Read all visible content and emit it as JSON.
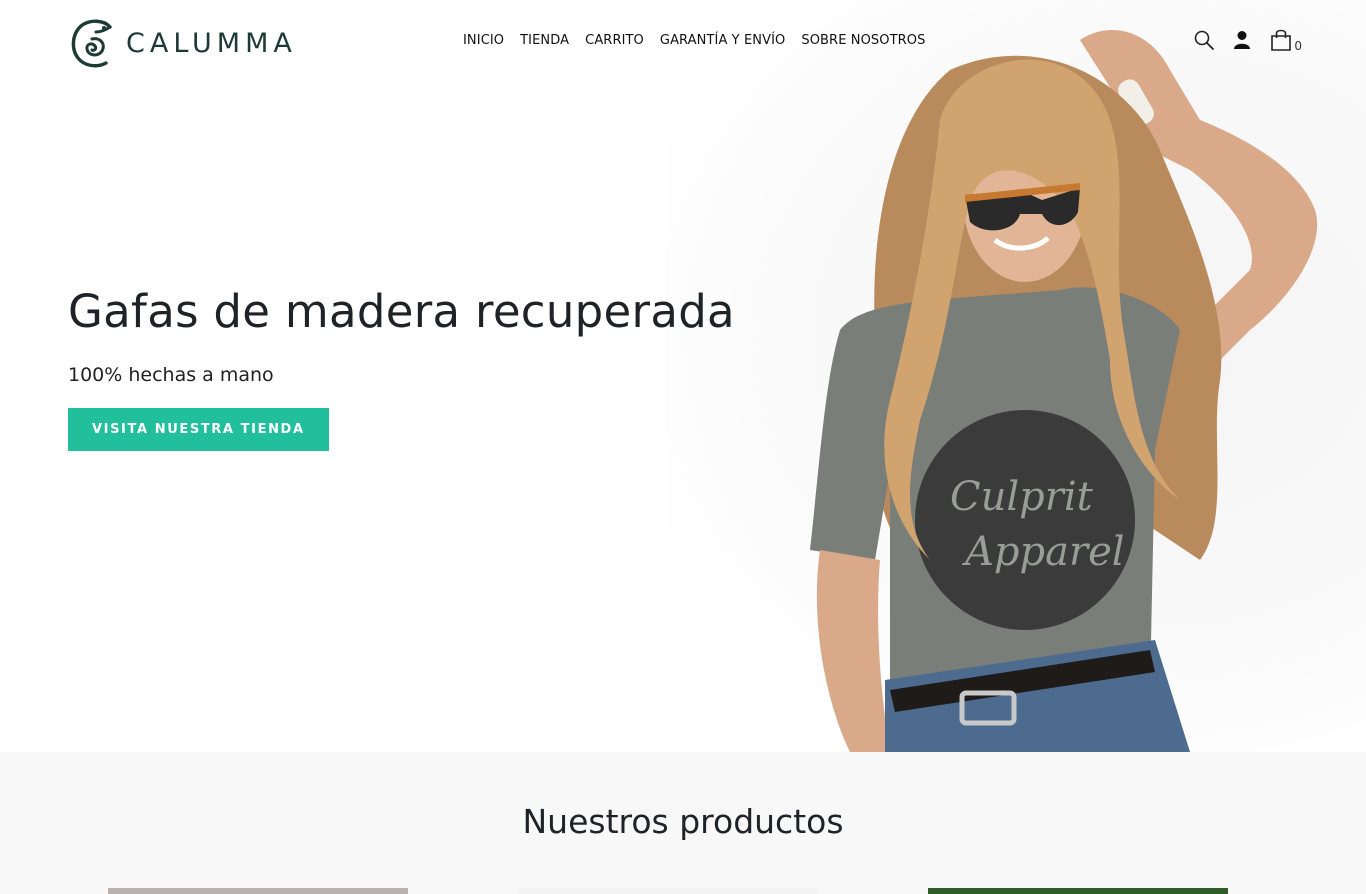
{
  "brand": {
    "name": "CALUMMA"
  },
  "nav": {
    "items": [
      {
        "label": "INICIO"
      },
      {
        "label": "TIENDA"
      },
      {
        "label": "CARRITO"
      },
      {
        "label": "GARANTÍA Y ENVÍO"
      },
      {
        "label": "SOBRE NOSOTROS"
      }
    ]
  },
  "header_icons": {
    "search": "search-icon",
    "account": "user-icon",
    "cart": "cart-icon",
    "cart_count": "0"
  },
  "hero": {
    "title": "Gafas de madera recuperada",
    "subtitle": "100% hechas a mano",
    "cta_label": "VISITA NUESTRA TIENDA",
    "shirt_text": "Culprit Apparel"
  },
  "products": {
    "title": "Nuestros productos"
  },
  "colors": {
    "accent": "#22bf9d",
    "brand_dark": "#1d3b34",
    "section_bg": "#f8f8f8"
  }
}
